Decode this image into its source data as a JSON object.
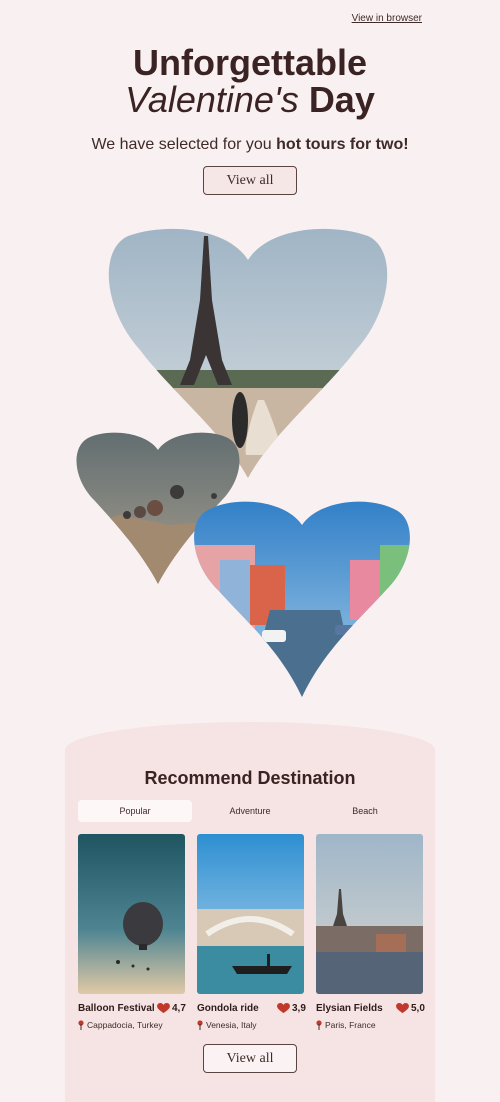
{
  "header": {
    "view_in_browser": "View in browser"
  },
  "hero": {
    "title_line1": "Unforgettable",
    "title_line2_italic": "Valentine's",
    "title_line2_bold": "Day",
    "subtitle_regular": "We have selected for you",
    "subtitle_bold": "hot tours for two!",
    "cta_label": "View all"
  },
  "recommend": {
    "title": "Recommend Destination",
    "tabs": [
      {
        "label": "Popular",
        "active": true
      },
      {
        "label": "Adventure",
        "active": false
      },
      {
        "label": "Beach",
        "active": false
      }
    ],
    "cards": [
      {
        "name": "Balloon Festival",
        "rating": "4,7",
        "location": "Cappadocia, Turkey"
      },
      {
        "name": "Gondola ride",
        "rating": "3,9",
        "location": "Venesia, Italy"
      },
      {
        "name": "Elysian Fields",
        "rating": "5,0",
        "location": "Paris, France"
      }
    ],
    "cta_label": "View all"
  },
  "colors": {
    "background": "#f9f1f1",
    "panel": "#f5e4e3",
    "text": "#3e2a28",
    "heart_rating": "#c0392b"
  }
}
